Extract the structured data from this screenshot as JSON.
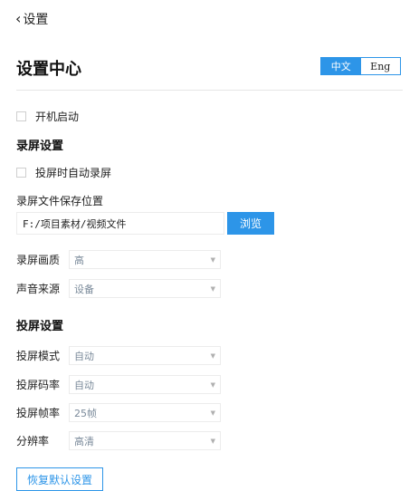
{
  "header": {
    "back_label": "设置",
    "back_icon": "chevron-left-icon"
  },
  "page": {
    "title": "设置中心"
  },
  "language": {
    "options": [
      "中文",
      "Eng"
    ],
    "active": "中文"
  },
  "general": {
    "autostart_label": "开机启动",
    "autostart_checked": false
  },
  "recording": {
    "section_title": "录屏设置",
    "auto_record_label": "投屏时自动录屏",
    "auto_record_checked": false,
    "save_path_label": "录屏文件保存位置",
    "save_path_value": "F:/项目素材/视频文件",
    "browse_label": "浏览",
    "quality": {
      "label": "录屏画质",
      "value": "高"
    },
    "audio_source": {
      "label": "声音来源",
      "value": "设备"
    }
  },
  "casting": {
    "section_title": "投屏设置",
    "mode": {
      "label": "投屏模式",
      "value": "自动"
    },
    "bitrate": {
      "label": "投屏码率",
      "value": "自动"
    },
    "framerate": {
      "label": "投屏帧率",
      "value": "25帧"
    },
    "resolution": {
      "label": "分辨率",
      "value": "高清"
    }
  },
  "footer": {
    "reset_label": "恢复默认设置"
  },
  "colors": {
    "accent": "#2d95e8",
    "border": "#ececec",
    "muted_text": "#7a8a9a"
  }
}
